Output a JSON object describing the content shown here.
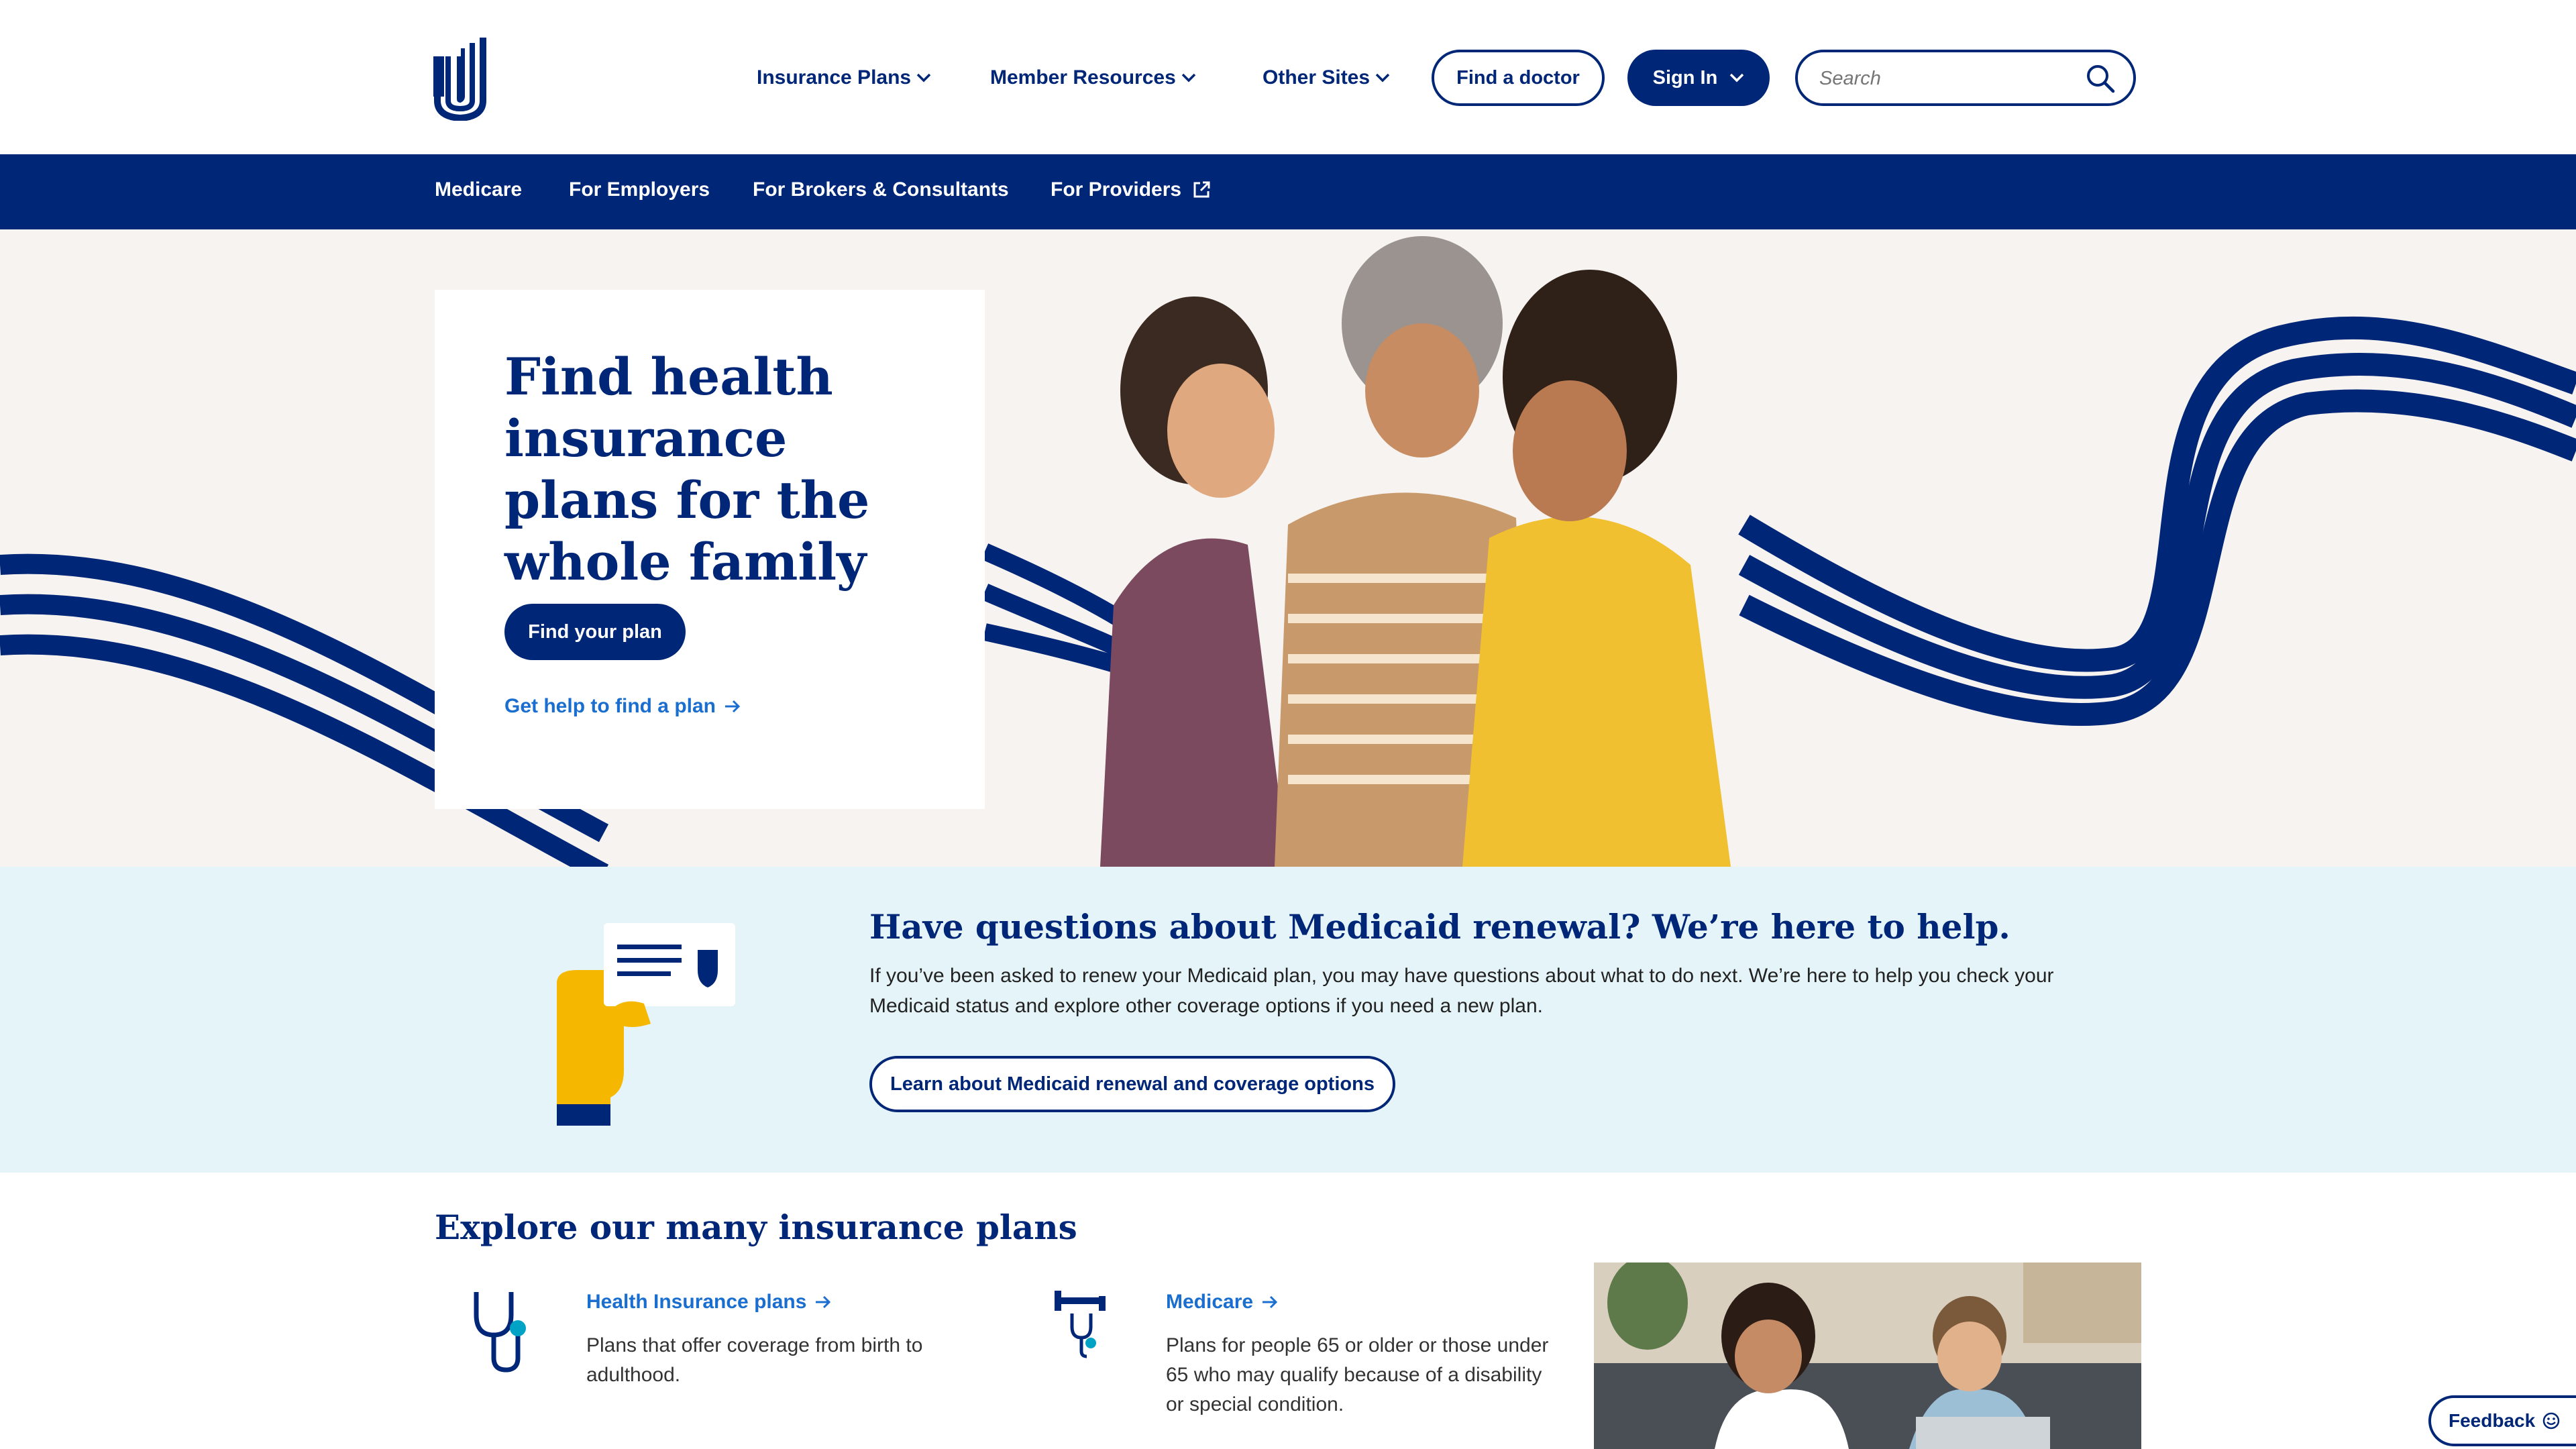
{
  "header": {
    "nav": [
      {
        "label": "Insurance Plans"
      },
      {
        "label": "Member Resources"
      },
      {
        "label": "Other Sites"
      }
    ],
    "find_doctor": "Find a doctor",
    "sign_in": "Sign In",
    "search_placeholder": "Search"
  },
  "subnav": {
    "items": [
      {
        "label": "Medicare"
      },
      {
        "label": "For Employers"
      },
      {
        "label": "For Brokers & Consultants"
      },
      {
        "label": "For Providers"
      }
    ]
  },
  "hero": {
    "title": "Find health insurance plans for the whole family",
    "cta": "Find your plan",
    "help_link": "Get help to find a plan"
  },
  "medicaid": {
    "title": "Have questions about Medicaid renewal? We’re here to help.",
    "text": "If you’ve been asked to renew your Medicaid plan, you may have questions about what to do next. We’re here to help you check your Medicaid status and explore other coverage options if you need a new plan.",
    "cta": "Learn about Medicaid renewal and coverage options"
  },
  "explore": {
    "title": "Explore our many insurance plans",
    "plans": [
      {
        "label": "Health Insurance plans",
        "desc": "Plans that offer coverage from birth to adulthood."
      },
      {
        "label": "Medicare",
        "desc": "Plans for people 65 or older or those under 65 who may qualify because of a disability or special condition."
      }
    ]
  },
  "feedback": "Feedback",
  "colors": {
    "brand_navy": "#002677",
    "link_blue": "#196ecf",
    "medicaid_bg": "#e5f4f8",
    "ribbon": "#002677",
    "accent_yellow": "#f5b700"
  }
}
